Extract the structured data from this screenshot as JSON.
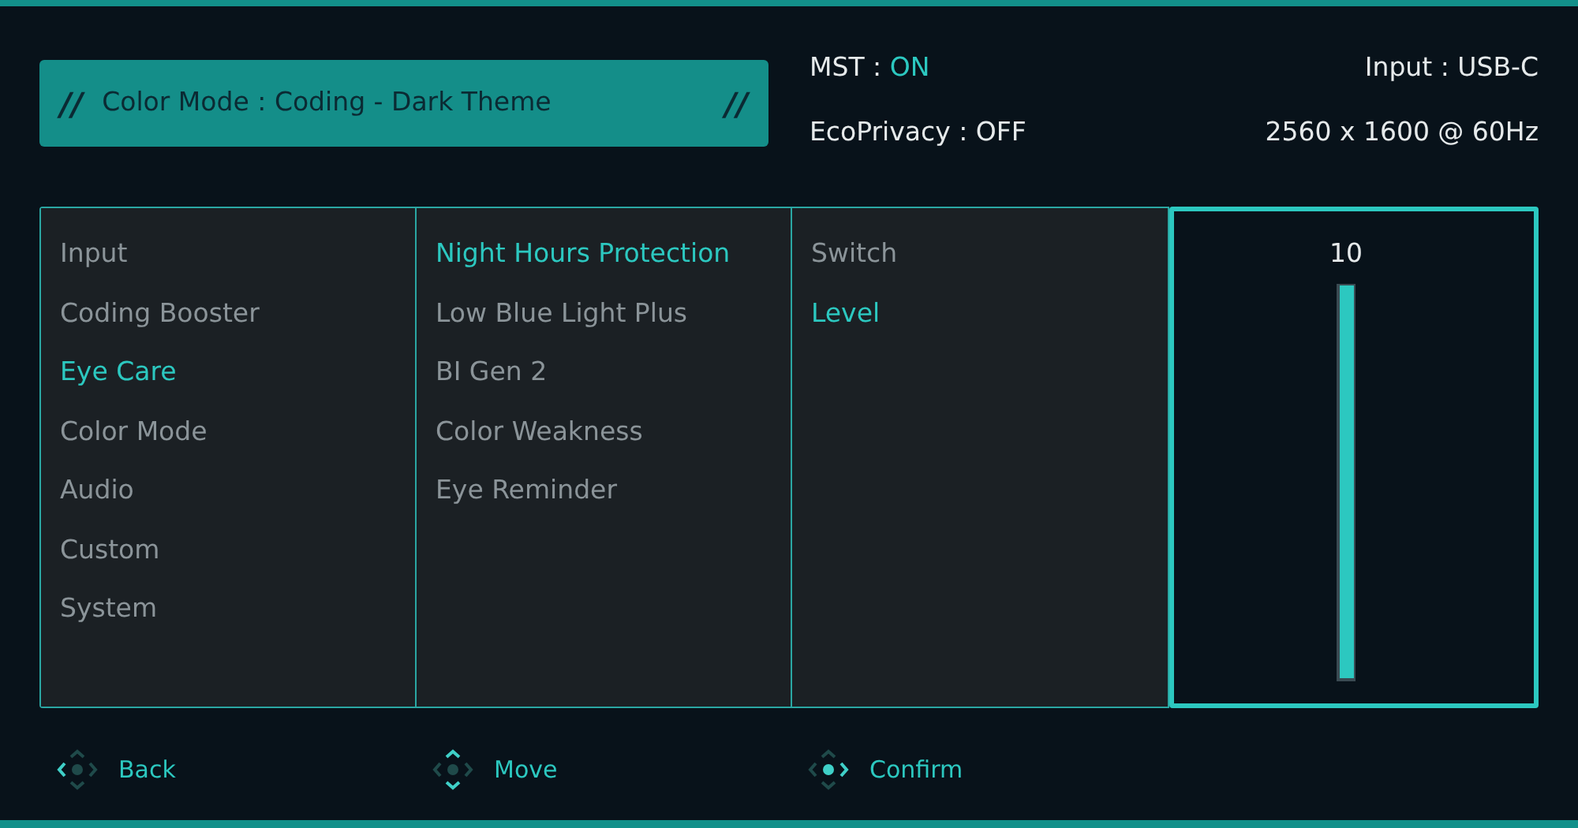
{
  "banner": {
    "label": "Color Mode : Coding - Dark Theme",
    "mark_left": "//",
    "mark_right": "//"
  },
  "status": [
    {
      "label": "MST : ",
      "value": "ON",
      "highlight": true
    },
    {
      "label": "Input : USB-C"
    },
    {
      "label": "EcoPrivacy : OFF"
    },
    {
      "label": "2560 x 1600 @ 60Hz"
    }
  ],
  "menu": [
    {
      "label": "Input",
      "selected": false
    },
    {
      "label": "Coding Booster",
      "selected": false
    },
    {
      "label": "Eye Care",
      "selected": true
    },
    {
      "label": "Color Mode",
      "selected": false
    },
    {
      "label": "Audio",
      "selected": false
    },
    {
      "label": "Custom",
      "selected": false
    },
    {
      "label": "System",
      "selected": false
    }
  ],
  "submenu": [
    {
      "label": "Night Hours Protection",
      "selected": true
    },
    {
      "label": "Low Blue Light Plus",
      "selected": false
    },
    {
      "label": "BI Gen 2",
      "selected": false
    },
    {
      "label": "Color Weakness",
      "selected": false
    },
    {
      "label": "Eye Reminder",
      "selected": false
    }
  ],
  "options": [
    {
      "label": "Switch",
      "selected": false
    },
    {
      "label": "Level",
      "selected": true
    }
  ],
  "slider": {
    "reading": "10",
    "level": 1
  },
  "footer": [
    {
      "kind": "back",
      "label": "Back"
    },
    {
      "kind": "move",
      "label": "Move"
    },
    {
      "kind": "confirm",
      "label": "Confirm"
    }
  ]
}
